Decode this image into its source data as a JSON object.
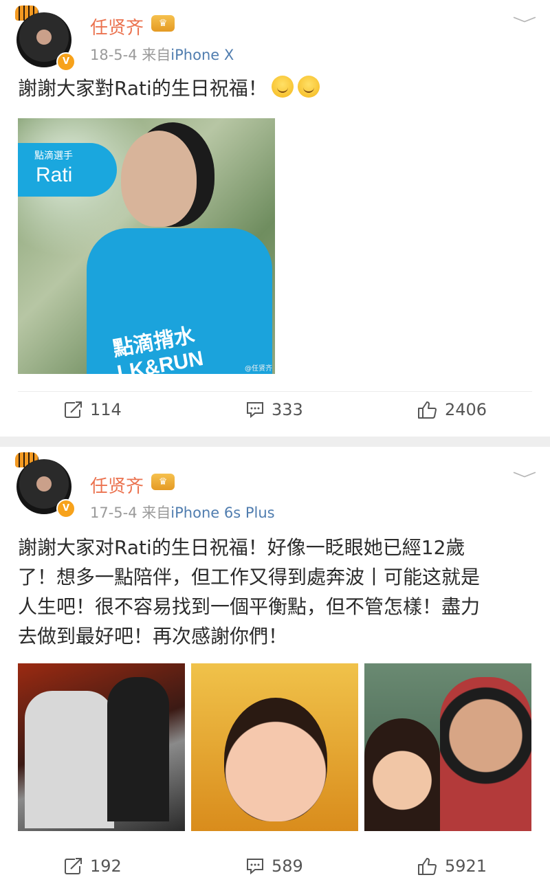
{
  "posts": [
    {
      "username": "任贤齐",
      "verified_badge": "V",
      "date": "18-5-4",
      "source_prefix": "来自",
      "device": "iPhone X",
      "text_lines": [
        "謝謝大家對Rati的生日祝福！"
      ],
      "image": {
        "tag_small": "點滴選手",
        "tag_big": "Rati",
        "shirt_text": "點滴揹水\nLK&RUN",
        "watermark": "@任贤齐"
      },
      "actions": {
        "repost": "114",
        "comment": "333",
        "like": "2406"
      }
    },
    {
      "username": "任贤齐",
      "verified_badge": "V",
      "date": "17-5-4",
      "source_prefix": "来自",
      "device": "iPhone 6s Plus",
      "text_lines": [
        "謝謝大家对Rati的生日祝福！好像一眨眼她已經12歲",
        "了！想多一點陪伴，但工作又得到處奔波丨可能这就是",
        "人生吧！很不容易找到一個平衡點，但不管怎樣！盡力",
        "去做到最好吧！再次感謝你們！"
      ],
      "actions": {
        "repost": "192",
        "comment": "589",
        "like": "5921"
      }
    }
  ],
  "icons": {
    "repost": "repost-icon",
    "comment": "comment-icon",
    "like": "thumbs-up-icon",
    "more": "chevron-down-icon"
  },
  "colors": {
    "username": "#eb7350",
    "device_link": "#507daf",
    "meta": "#9a9a9a",
    "badge": "#f7a21b",
    "tag_blue": "#1aa7de"
  }
}
